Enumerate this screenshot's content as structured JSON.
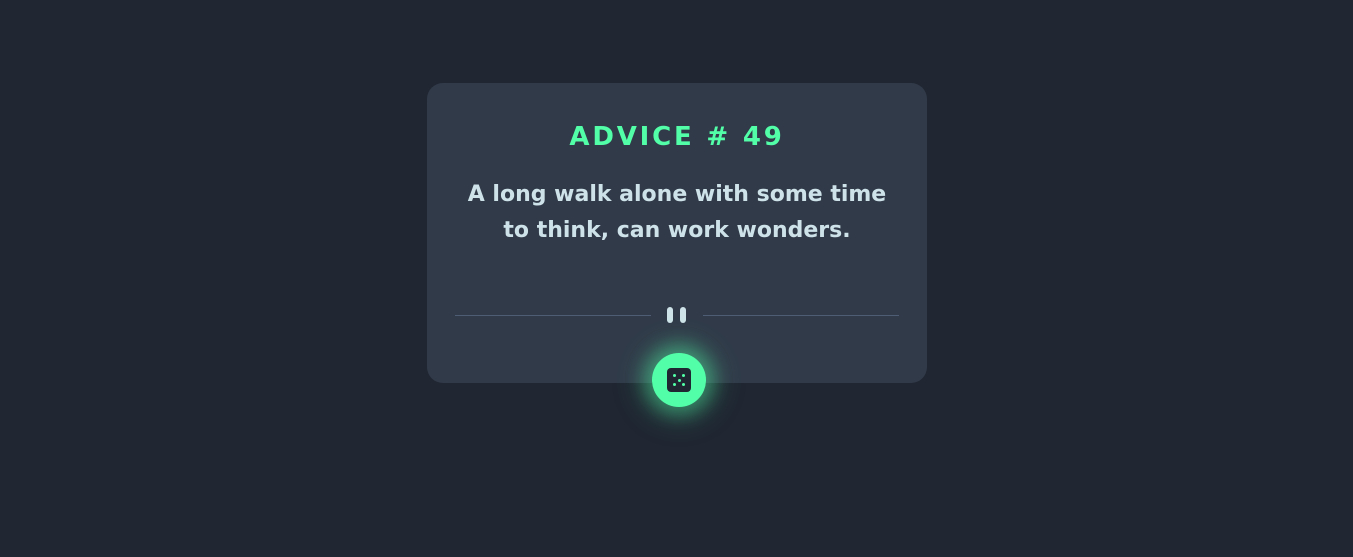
{
  "advice": {
    "id_label": "ADVICE # 49",
    "text": "A long walk alone with some time to think, can work wonders."
  },
  "icons": {
    "divider": "pause-icon",
    "button": "dice-icon"
  },
  "colors": {
    "page_background": "#202632",
    "card_background": "#313a49",
    "accent": "#52ffa8",
    "text": "#cee3e9",
    "divider": "#4f5d74"
  }
}
